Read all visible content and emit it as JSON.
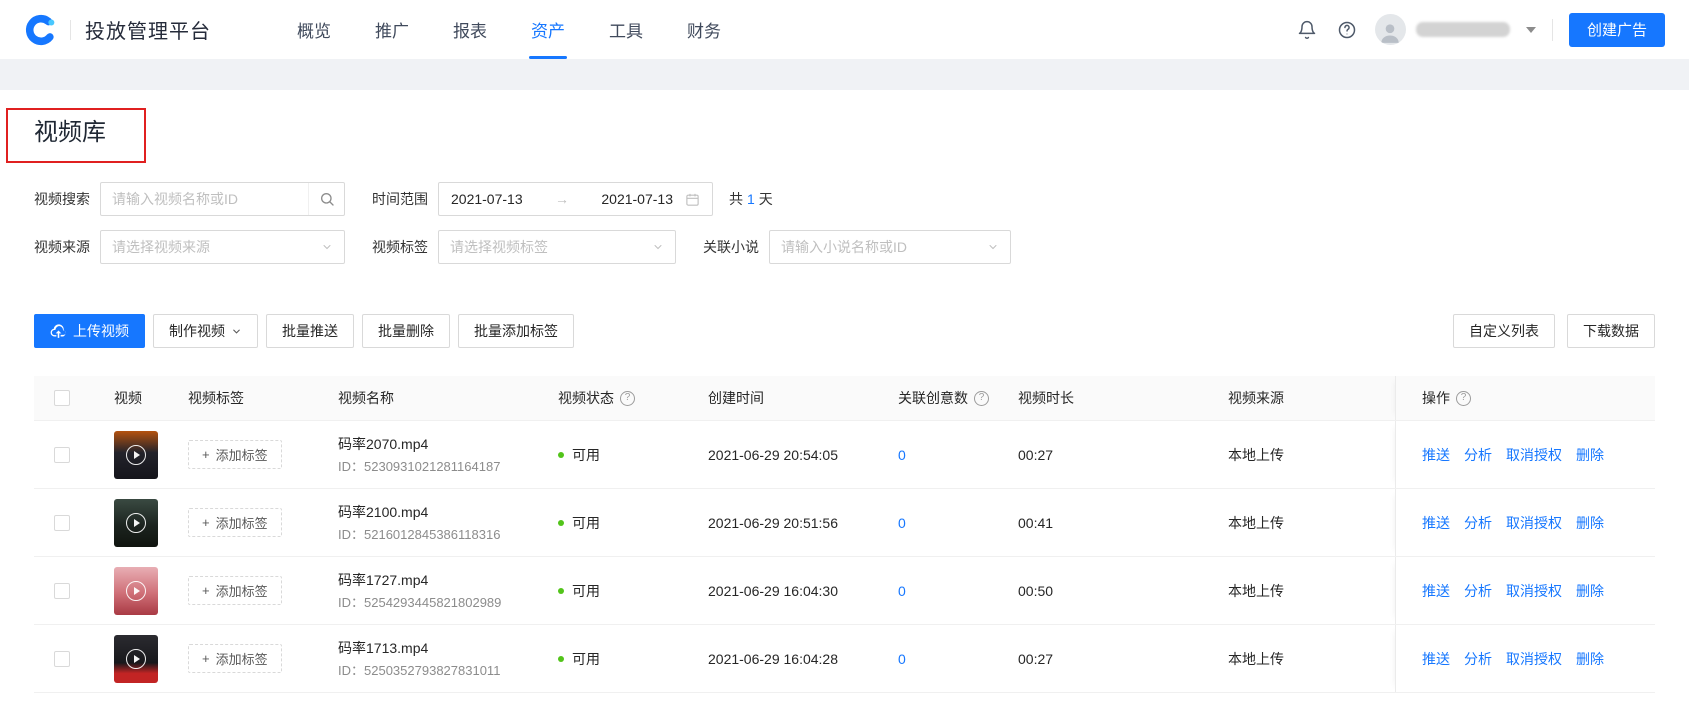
{
  "colors": {
    "accent": "#1677ff",
    "link": "#1677ff",
    "success_dot": "#52c41a",
    "annotation_box": "#e02020"
  },
  "icons": {
    "plus": "+",
    "question": "?"
  },
  "header": {
    "title": "投放管理平台",
    "nav": [
      {
        "label": "概览",
        "active": false
      },
      {
        "label": "推广",
        "active": false
      },
      {
        "label": "报表",
        "active": false
      },
      {
        "label": "资产",
        "active": true
      },
      {
        "label": "工具",
        "active": false
      },
      {
        "label": "财务",
        "active": false
      }
    ],
    "create_ad_button": "创建广告"
  },
  "page": {
    "title": "视频库"
  },
  "filters": {
    "search_label": "视频搜索",
    "search_placeholder": "请输入视频名称或ID",
    "date_label": "时间范围",
    "date_start": "2021-07-13",
    "date_arrow": "→",
    "date_end": "2021-07-13",
    "days_prefix": "共",
    "days_value": "1",
    "days_suffix": "天",
    "source_label": "视频来源",
    "source_placeholder": "请选择视频来源",
    "tag_label": "视频标签",
    "tag_placeholder": "请选择视频标签",
    "novel_label": "关联小说",
    "novel_placeholder": "请输入小说名称或ID"
  },
  "toolbar": {
    "upload_button": "上传视频",
    "make_video_button": "制作视频",
    "batch_push_button": "批量推送",
    "batch_delete_button": "批量删除",
    "batch_add_tag_button": "批量添加标签",
    "custom_columns_button": "自定义列表",
    "download_button": "下载数据"
  },
  "table": {
    "headers": [
      "视频",
      "视频标签",
      "视频名称",
      "视频状态",
      "创建时间",
      "关联创意数",
      "视频时长",
      "视频来源",
      "操作"
    ],
    "add_tag_label": "添加标签",
    "id_prefix": "ID：",
    "actions": [
      "推送",
      "分析",
      "取消授权",
      "删除"
    ],
    "rows": [
      {
        "name": "码率2070.mp4",
        "id": "5230931021281164187",
        "status": "可用",
        "created": "2021-06-29 20:54:05",
        "creatives": "0",
        "duration": "00:27",
        "source": "本地上传",
        "thumb_gradient": [
          "#b4520f 0%",
          "#23232b 45%",
          "#15151b 100%"
        ]
      },
      {
        "name": "码率2100.mp4",
        "id": "5216012845386118316",
        "status": "可用",
        "created": "2021-06-29 20:51:56",
        "creatives": "0",
        "duration": "00:41",
        "source": "本地上传",
        "thumb_gradient": [
          "#3a4a42 0%",
          "#1c241f 55%",
          "#10140f 100%"
        ]
      },
      {
        "name": "码率1727.mp4",
        "id": "5254293445821802989",
        "status": "可用",
        "created": "2021-06-29 16:04:30",
        "creatives": "0",
        "duration": "00:50",
        "source": "本地上传",
        "thumb_gradient": [
          "#e8aeb4 0%",
          "#cf6f77 55%",
          "#a93a44 100%"
        ]
      },
      {
        "name": "码率1713.mp4",
        "id": "5250352793827831011",
        "status": "可用",
        "created": "2021-06-29 16:04:28",
        "creatives": "0",
        "duration": "00:27",
        "source": "本地上传",
        "thumb_gradient": [
          "#2b2b30 0%",
          "#18181c 58%",
          "#c22424 80%",
          "#c22424 100%"
        ]
      }
    ]
  }
}
